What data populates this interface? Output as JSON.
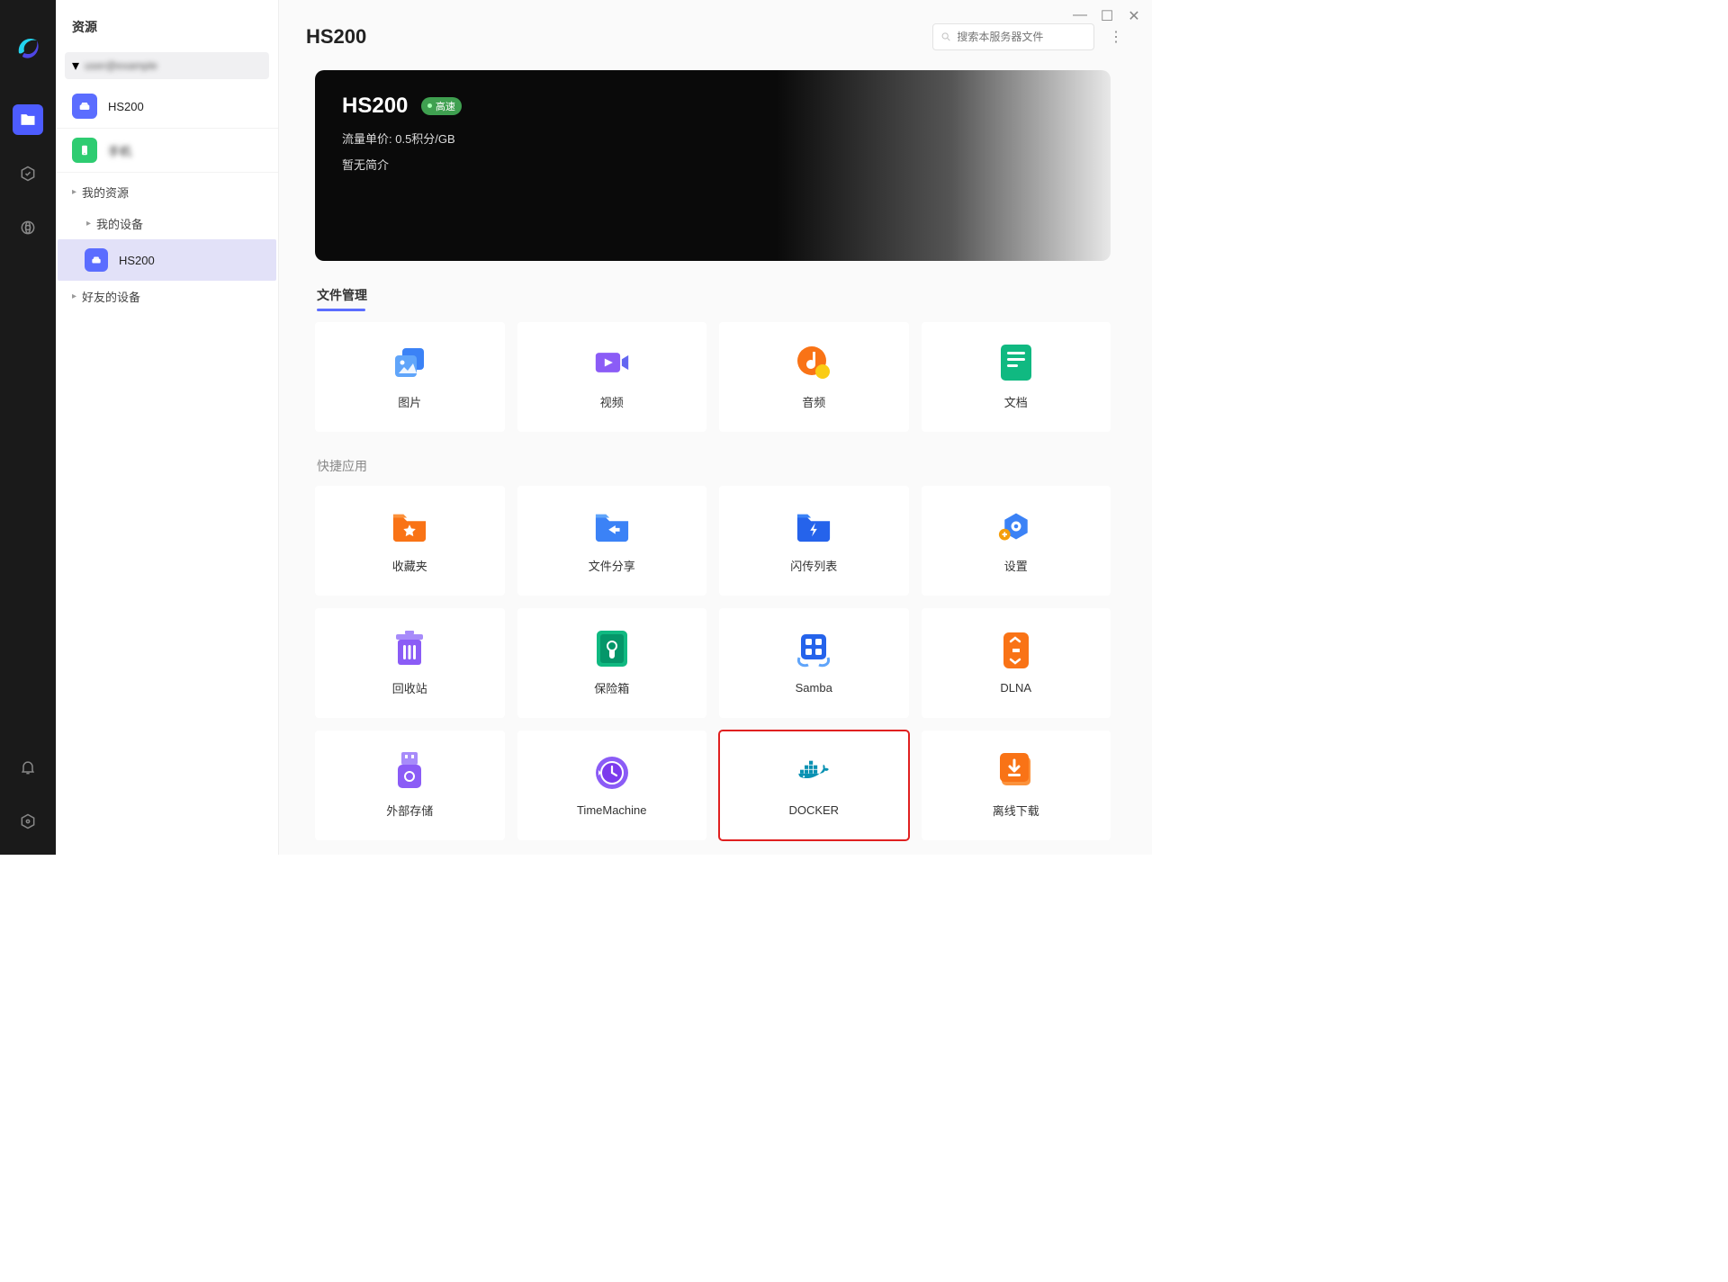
{
  "sidebar": {
    "title": "资源",
    "account_placeholder": "user@example",
    "devices": [
      {
        "label": "HS200",
        "icon": "server"
      },
      {
        "label": "手机",
        "icon": "phone"
      }
    ],
    "tree": {
      "my_resources": "我的资源",
      "my_devices": "我的设备",
      "friend_devices": "好友的设备",
      "selected_leaf": "HS200"
    }
  },
  "header": {
    "title": "HS200",
    "search_placeholder": "搜索本服务器文件"
  },
  "banner": {
    "name": "HS200",
    "badge": "高速",
    "meta": "流量单价: 0.5积分/GB",
    "desc": "暂无简介"
  },
  "sections": {
    "file_manage": "文件管理",
    "quick_apps": "快捷应用"
  },
  "file_tiles": [
    {
      "label": "图片",
      "icon": "image"
    },
    {
      "label": "视频",
      "icon": "video"
    },
    {
      "label": "音频",
      "icon": "audio"
    },
    {
      "label": "文档",
      "icon": "doc"
    }
  ],
  "app_tiles": [
    {
      "label": "收藏夹",
      "icon": "star-folder"
    },
    {
      "label": "文件分享",
      "icon": "share-folder"
    },
    {
      "label": "闪传列表",
      "icon": "bolt-folder"
    },
    {
      "label": "设置",
      "icon": "settings"
    },
    {
      "label": "回收站",
      "icon": "trash"
    },
    {
      "label": "保险箱",
      "icon": "safe"
    },
    {
      "label": "Samba",
      "icon": "samba"
    },
    {
      "label": "DLNA",
      "icon": "dlna"
    },
    {
      "label": "外部存储",
      "icon": "usb"
    },
    {
      "label": "TimeMachine",
      "icon": "timemachine"
    },
    {
      "label": "DOCKER",
      "icon": "docker",
      "highlight": true
    },
    {
      "label": "离线下载",
      "icon": "download"
    }
  ]
}
